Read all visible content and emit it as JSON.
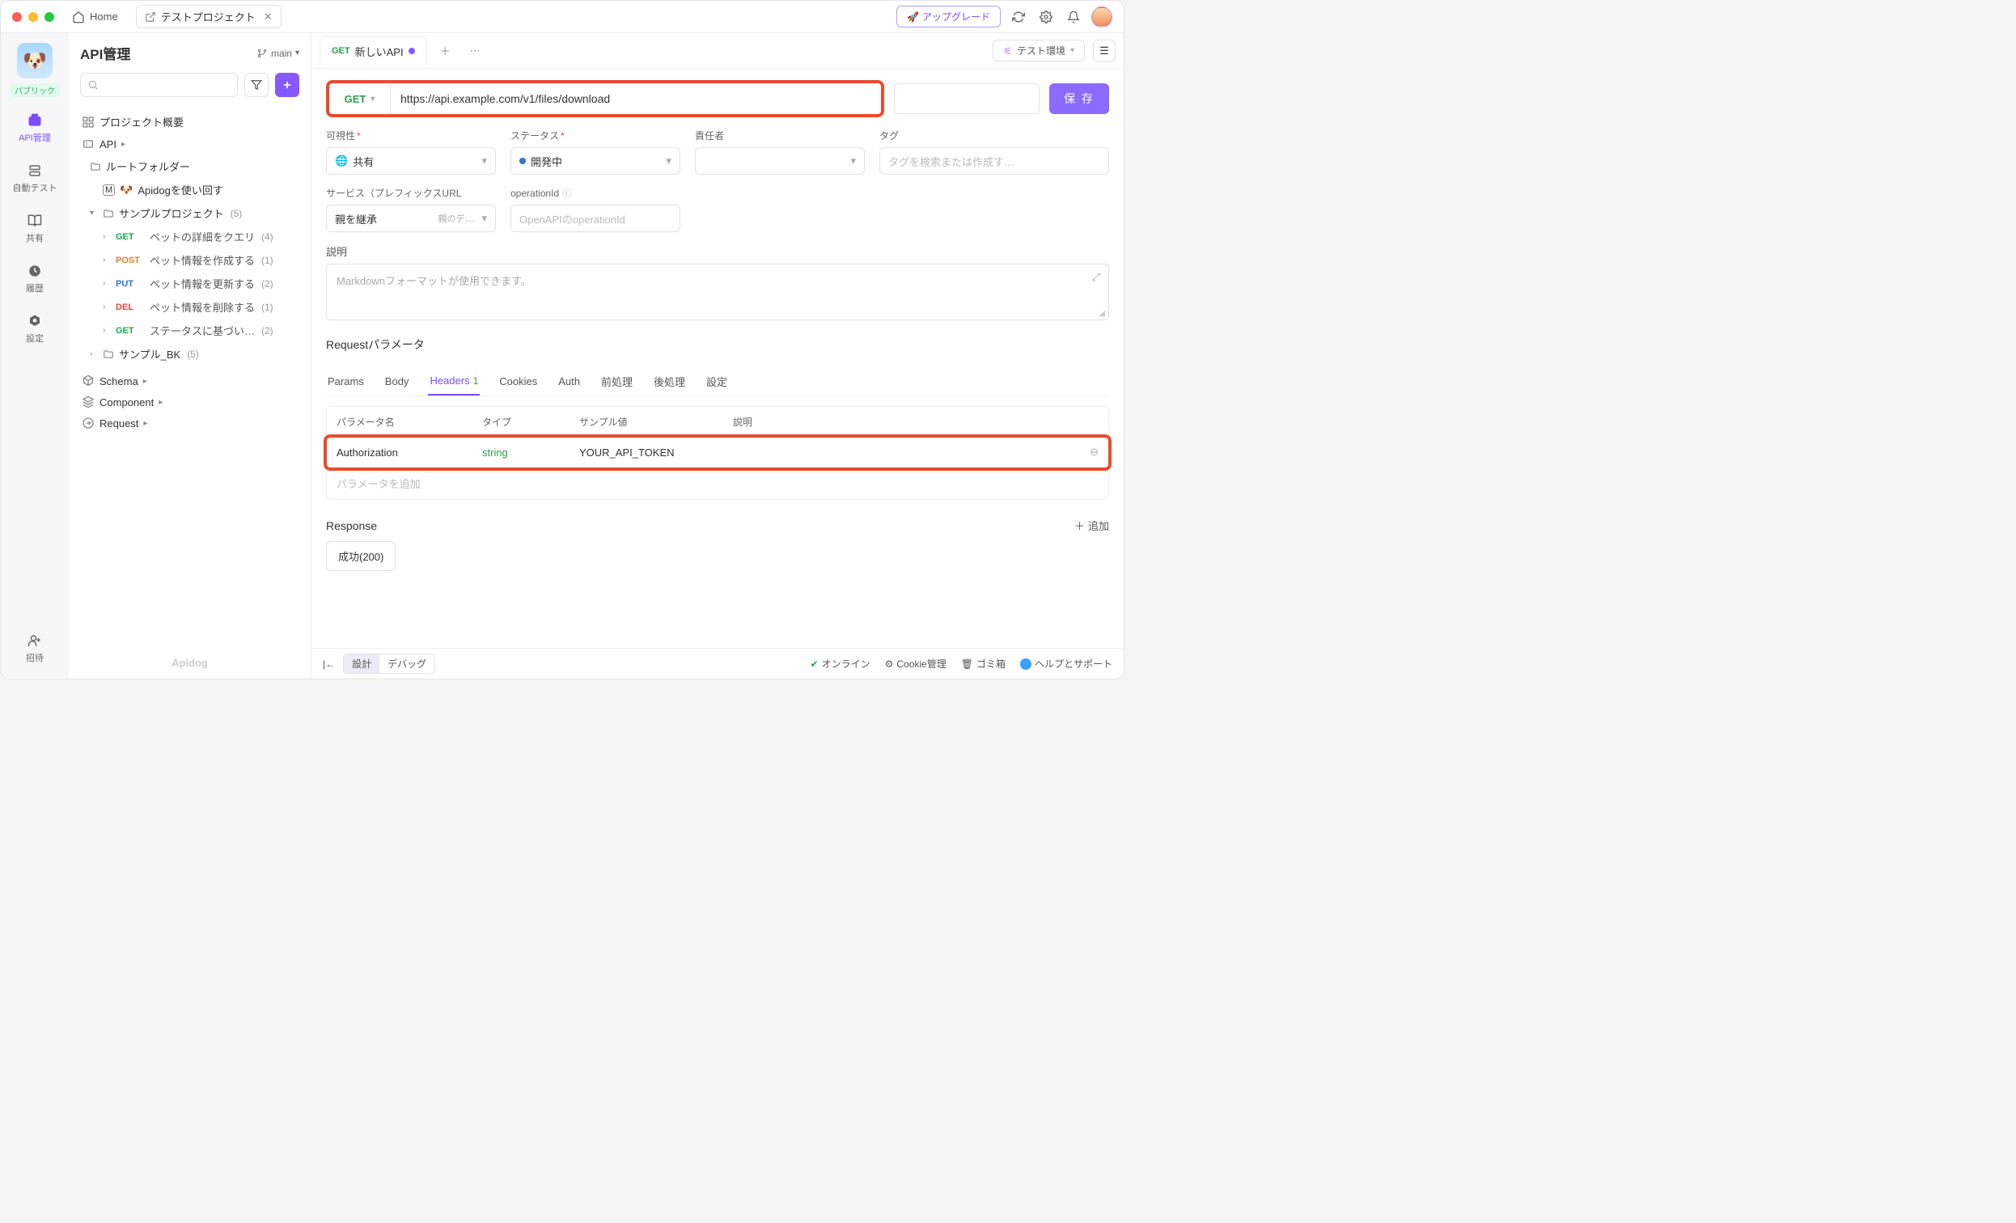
{
  "titlebar": {
    "home": "Home",
    "project_tab": "テストプロジェクト",
    "upgrade": "アップグレード"
  },
  "navrail": {
    "public_badge": "パブリック",
    "items": [
      {
        "label": "API管理"
      },
      {
        "label": "自動テスト"
      },
      {
        "label": "共有"
      },
      {
        "label": "履歴"
      },
      {
        "label": "設定"
      },
      {
        "label": "招待"
      }
    ]
  },
  "sidebar": {
    "title": "API管理",
    "branch": "main",
    "overview": "プロジェクト概要",
    "api_root": "API",
    "root_folder": "ルートフォルダー",
    "apidog_guide": "Apidogを使い回す",
    "sample_project": "サンプルプロジェクト",
    "sample_project_count": "(5)",
    "endpoints": [
      {
        "method": "GET",
        "name": "ペットの詳細をクエリ",
        "count": "(4)"
      },
      {
        "method": "POST",
        "name": "ペット情報を作成する",
        "count": "(1)"
      },
      {
        "method": "PUT",
        "name": "ペット情報を更新する",
        "count": "(2)"
      },
      {
        "method": "DEL",
        "name": "ペット情報を削除する",
        "count": "(1)"
      },
      {
        "method": "GET",
        "name": "ステータスに基づい…",
        "count": "(2)"
      }
    ],
    "sample_bk": "サンプル_BK",
    "sample_bk_count": "(5)",
    "schema": "Schema",
    "component": "Component",
    "request": "Request",
    "footer_brand": "Apidog"
  },
  "tabbar": {
    "method": "GET",
    "title": "新しいAPI",
    "env": "テスト環境"
  },
  "url": {
    "method": "GET",
    "value": "https://api.example.com/v1/files/download",
    "save": "保 存"
  },
  "meta": {
    "visibility_label": "可視性",
    "visibility_value": "共有",
    "status_label": "ステータス",
    "status_value": "開発中",
    "owner_label": "責任者",
    "tag_label": "タグ",
    "tag_placeholder": "タグを検索または作成す…",
    "service_label": "サービス（プレフィックスURL",
    "service_value": "親を継承",
    "service_hint": "親のデ…",
    "opid_label": "operationId",
    "opid_placeholder": "OpenAPIのoperationId",
    "desc_label": "説明",
    "desc_placeholder": "Markdownフォーマットが使用できます。"
  },
  "params": {
    "section": "Requestパラメータ",
    "tabs": [
      "Params",
      "Body",
      "Headers",
      "Cookies",
      "Auth",
      "前処理",
      "後処理",
      "設定"
    ],
    "headers_count": "1",
    "columns": {
      "name": "パラメータ名",
      "type": "タイプ",
      "sample": "サンプル値",
      "desc": "説明"
    },
    "row": {
      "name": "Authorization",
      "type": "string",
      "sample": "YOUR_API_TOKEN",
      "desc": ""
    },
    "add_placeholder": "パラメータを追加"
  },
  "response": {
    "section": "Response",
    "chip": "成功(200)",
    "add": "追加"
  },
  "footer": {
    "design": "設計",
    "debug": "デバッグ",
    "online": "オンライン",
    "cookie": "Cookie管理",
    "trash": "ゴミ箱",
    "help": "ヘルプとサポート"
  }
}
